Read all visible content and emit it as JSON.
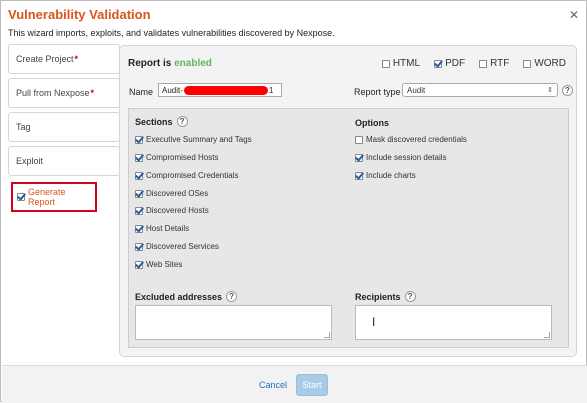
{
  "dialog": {
    "title": "Vulnerability Validation",
    "subtitle": "This wizard imports, exploits, and validates vulnerabilities discovered by Nexpose.",
    "close_glyph": "✕"
  },
  "steps": [
    {
      "label": "Create Project",
      "required": "*"
    },
    {
      "label": "Pull from Nexpose",
      "required": "*"
    },
    {
      "label": "Tag",
      "required": ""
    },
    {
      "label": "Exploit",
      "required": ""
    },
    {
      "label": "Generate Report",
      "required": "",
      "checked": true
    }
  ],
  "report": {
    "status_prefix": "Report is",
    "status_value": "enabled",
    "formats": [
      {
        "label": "HTML",
        "checked": false
      },
      {
        "label": "PDF",
        "checked": true
      },
      {
        "label": "RTF",
        "checked": false
      },
      {
        "label": "WORD",
        "checked": false
      }
    ],
    "name_label": "Name",
    "name_value_start": "Audit-",
    "name_value_end": "1",
    "type_label": "Report type",
    "type_value": "Audit",
    "help_glyph": "?",
    "sections_title": "Sections",
    "sections": [
      {
        "label": "Executive Summary and Tags",
        "checked": true
      },
      {
        "label": "Compromised Hosts",
        "checked": true
      },
      {
        "label": "Compromised Credentials",
        "checked": true
      },
      {
        "label": "Discovered OSes",
        "checked": true
      },
      {
        "label": "Discovered Hosts",
        "checked": true
      },
      {
        "label": "Host Details",
        "checked": true
      },
      {
        "label": "Discovered Services",
        "checked": true
      },
      {
        "label": "Web Sites",
        "checked": true
      }
    ],
    "options_title": "Options",
    "options": [
      {
        "label": "Mask discovered credentials",
        "checked": false
      },
      {
        "label": "Include session details",
        "checked": true
      },
      {
        "label": "Include charts",
        "checked": true
      }
    ],
    "excluded_label": "Excluded addresses",
    "recipients_label": "Recipients",
    "text_cursor_glyph": "I"
  },
  "footer": {
    "cancel_label": "Cancel",
    "start_label": "Start"
  },
  "colors": {
    "title": "#d9541e",
    "enabled": "#5cb85c",
    "redaction": "#ff0000",
    "active_step_border": "#d0021b",
    "start_button": "#a8cce6"
  }
}
